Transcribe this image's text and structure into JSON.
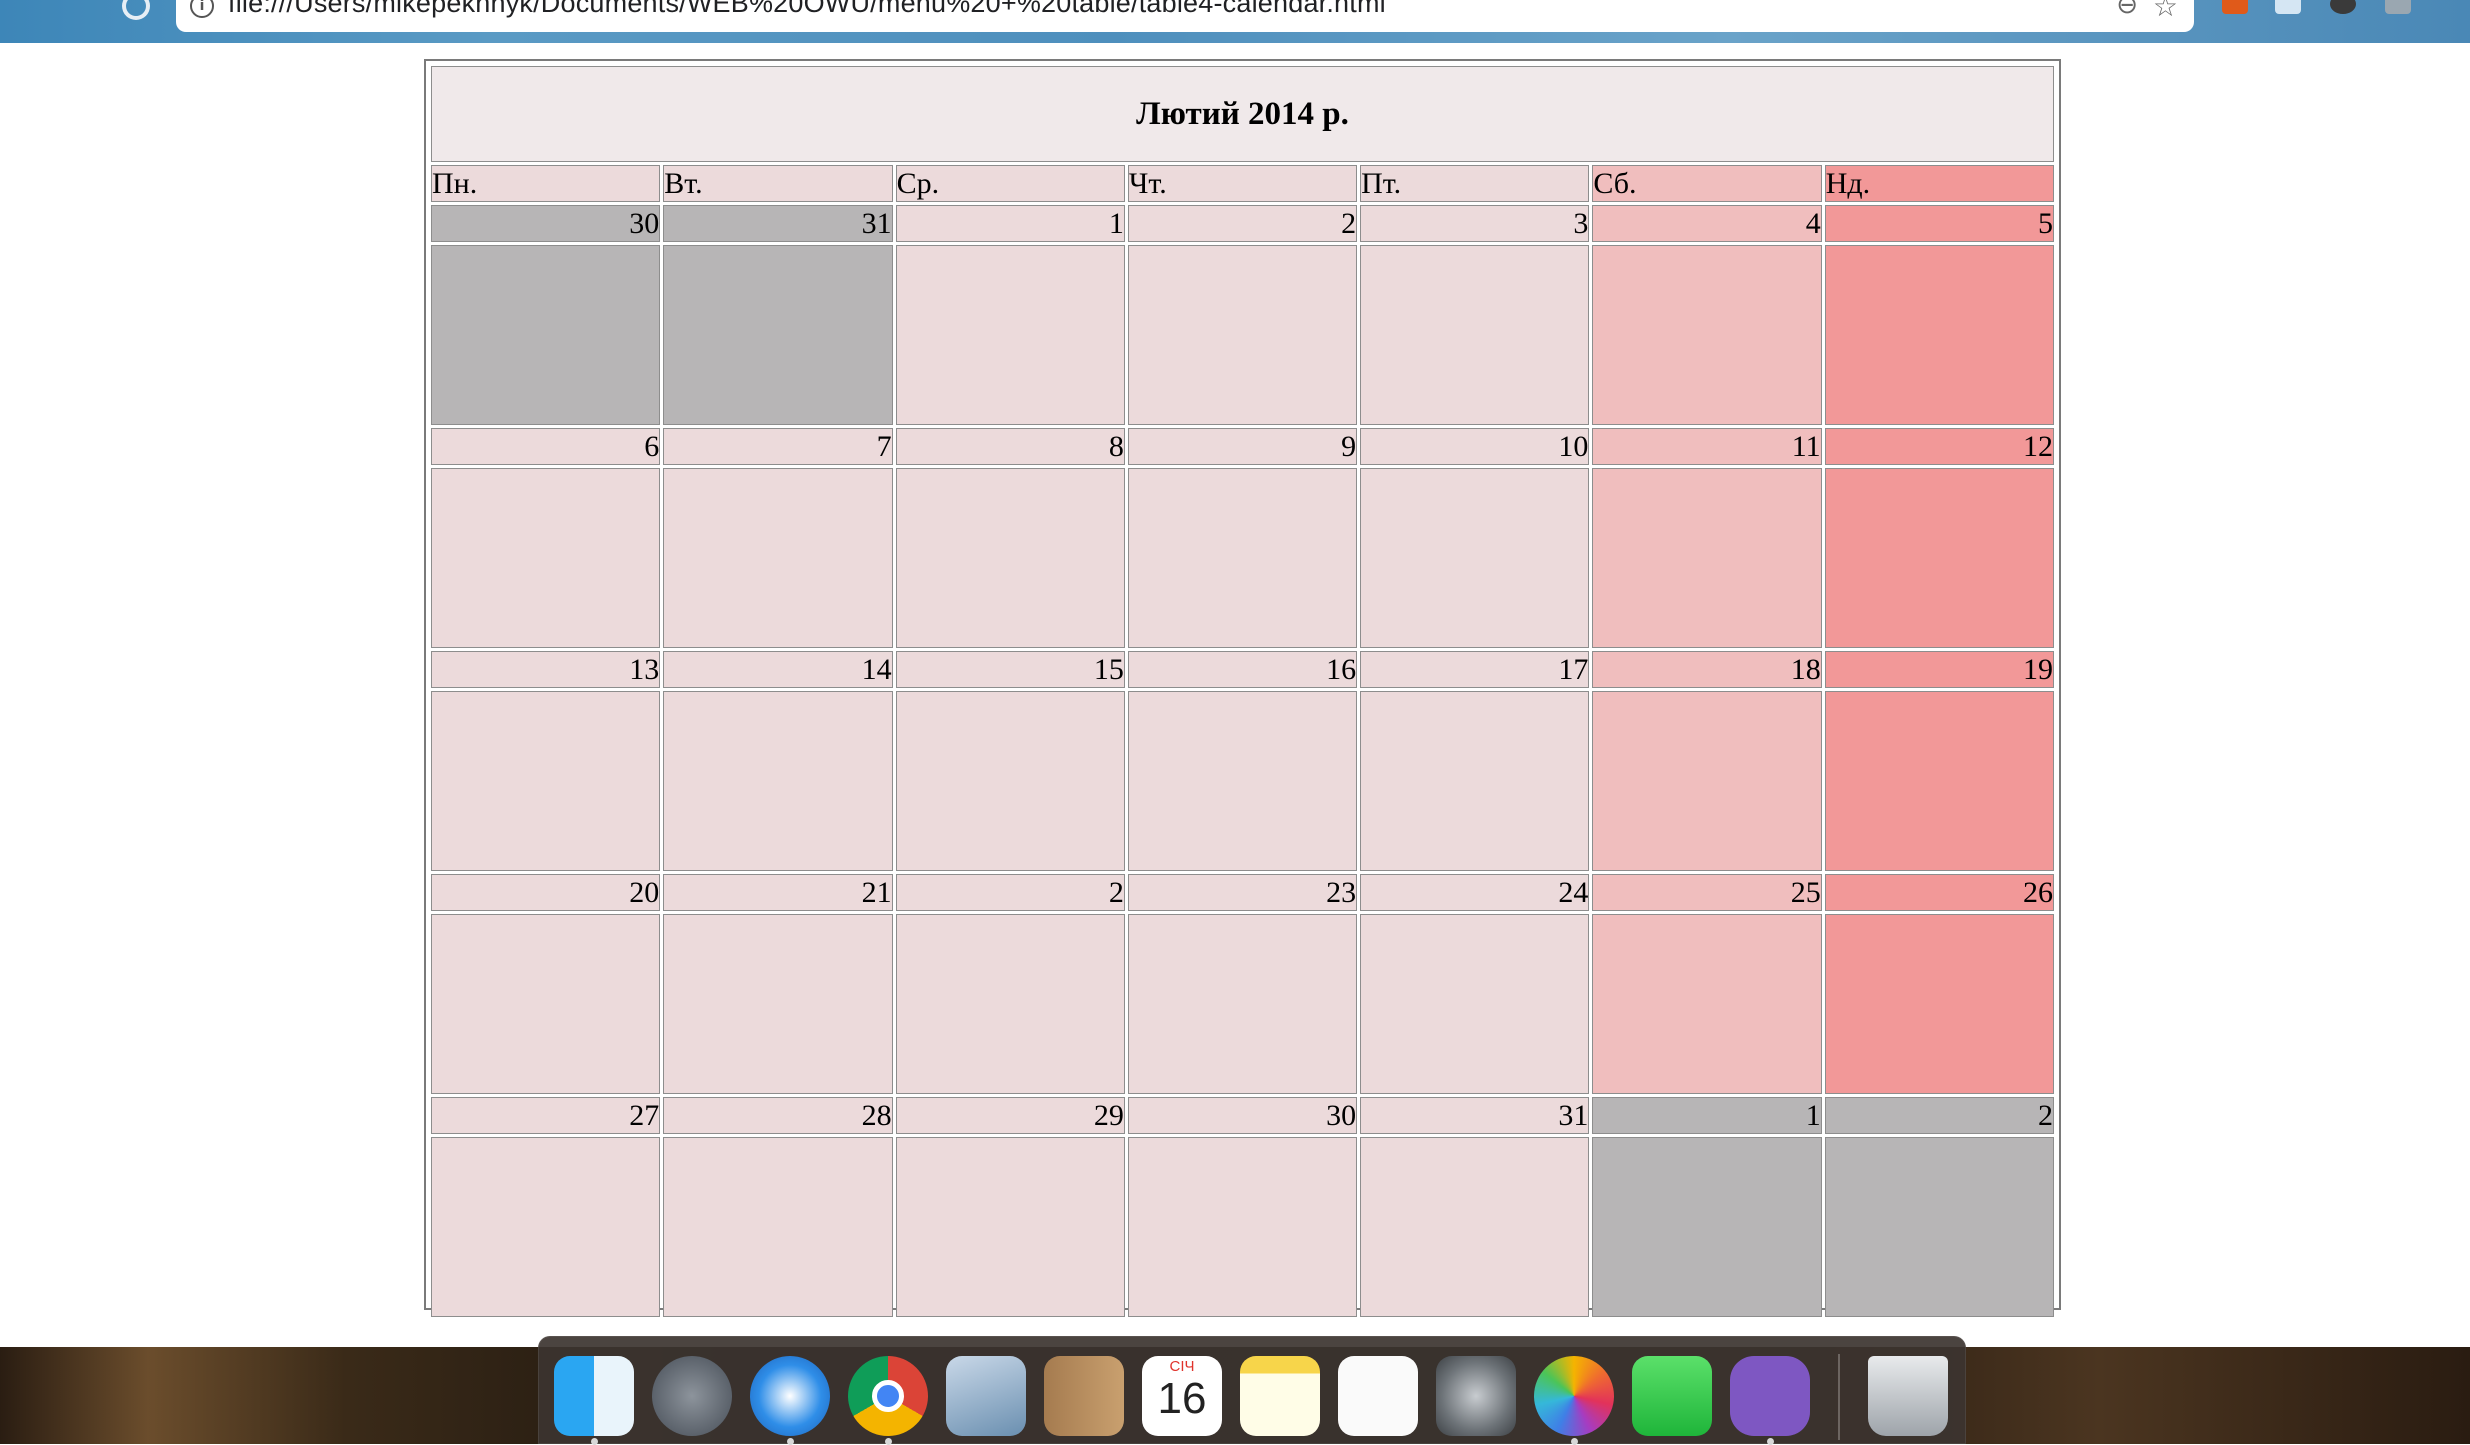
{
  "browser": {
    "url": "file:///Users/mikepekhnyk/Documents/WEB%20OWU/menu%20+%20table/table4-calendar.html"
  },
  "calendar": {
    "title": "Лютий 2014 р.",
    "weekdays": [
      "Пн.",
      "Вт.",
      "Ср.",
      "Чт.",
      "Пт.",
      "Сб.",
      "Нд."
    ],
    "weeks": [
      [
        "30",
        "31",
        "1",
        "2",
        "3",
        "4",
        "5"
      ],
      [
        "6",
        "7",
        "8",
        "9",
        "10",
        "11",
        "12"
      ],
      [
        "13",
        "14",
        "15",
        "16",
        "17",
        "18",
        "19"
      ],
      [
        "20",
        "21",
        "2",
        "23",
        "24",
        "25",
        "26"
      ],
      [
        "27",
        "28",
        "29",
        "30",
        "31",
        "1",
        "2"
      ]
    ]
  },
  "colors": {
    "weekday_cell": "#ecdadb",
    "saturday_cell": "#f0bebe",
    "sunday_cell": "#f29898",
    "other_month_cell": "#b7b5b6",
    "title_cell": "#f0e9ea"
  },
  "dock": {
    "apps": [
      "finder-icon",
      "launchpad-icon",
      "safari-icon",
      "chrome-icon",
      "mail-icon",
      "contacts-icon",
      "calendar-icon",
      "notes-icon",
      "reminders-icon",
      "system-preferences-icon",
      "photos-icon",
      "facetime-icon",
      "viber-icon",
      "trash-icon"
    ],
    "calendar_month": "СІЧ",
    "calendar_day": "16"
  }
}
